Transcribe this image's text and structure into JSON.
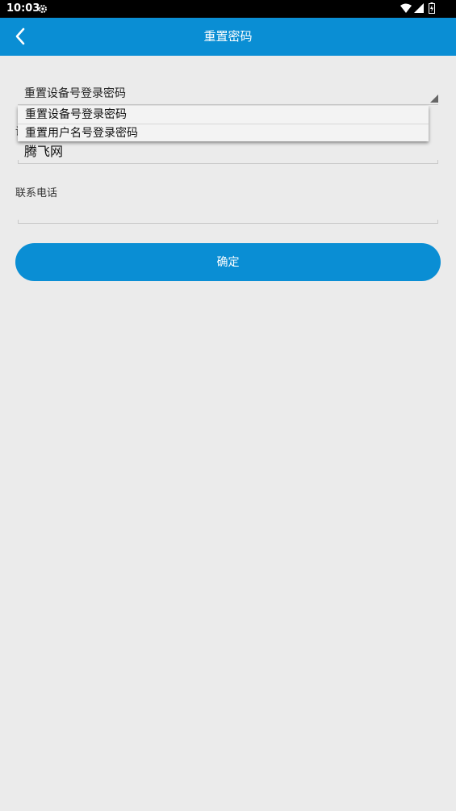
{
  "status_bar": {
    "time": "10:03"
  },
  "app_bar": {
    "title": "重置密码"
  },
  "spinner": {
    "selected": "重置设备号登录密码"
  },
  "dropdown": {
    "options": [
      "重置设备号登录密码",
      "重置用户名号登录密码"
    ]
  },
  "form": {
    "field1_label": "设",
    "field1_value": "腾飞网",
    "phone_label": "联系电话",
    "phone_value": ""
  },
  "confirm_label": "确定",
  "colors": {
    "primary": "#0a8ed4",
    "background": "#ebebeb"
  }
}
